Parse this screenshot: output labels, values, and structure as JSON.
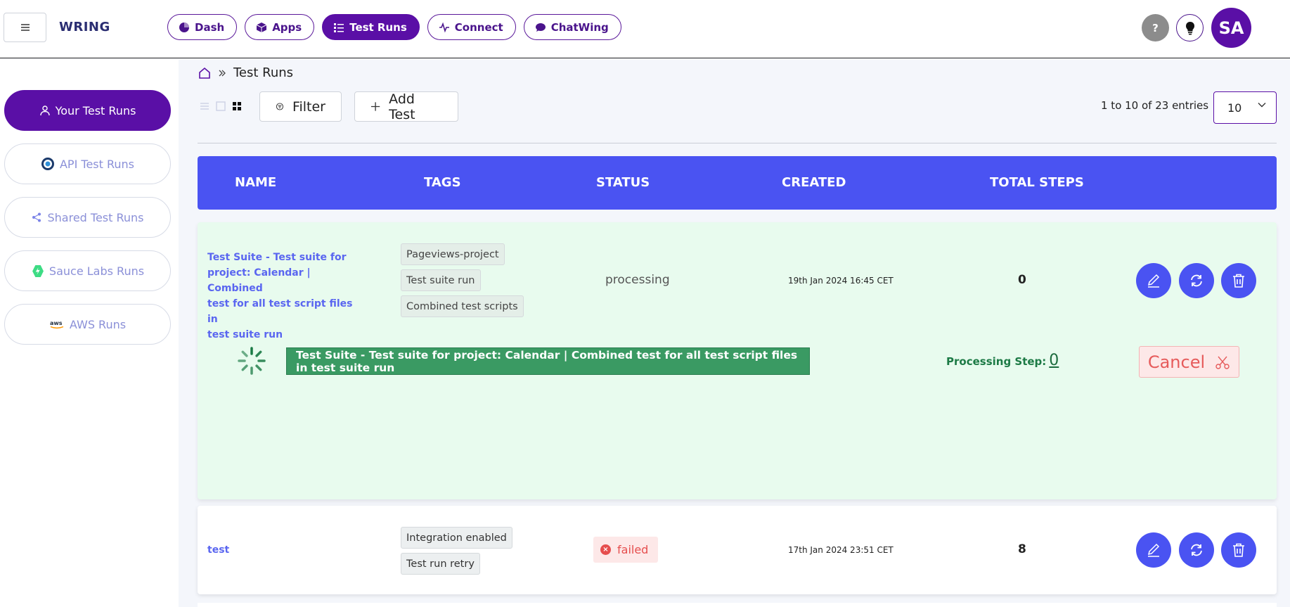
{
  "header": {
    "menu_icon": "hamburger-icon",
    "brand": "WRING",
    "nav": [
      {
        "label": "Dash",
        "icon": "pie-chart-icon"
      },
      {
        "label": "Apps",
        "icon": "cube-icon"
      },
      {
        "label": "Test Runs",
        "icon": "list-icon",
        "active": true
      },
      {
        "label": "Connect",
        "icon": "pulse-icon"
      },
      {
        "label": "ChatWing",
        "icon": "chat-bubble-icon"
      }
    ],
    "help_label": "?",
    "avatar_initials": "SA"
  },
  "sidebar": {
    "items": [
      {
        "label": "Your Test Runs",
        "icon": "user-icon",
        "active": true
      },
      {
        "label": "API Test Runs",
        "icon": "api-globe-icon"
      },
      {
        "label": "Shared Test Runs",
        "icon": "share-icon"
      },
      {
        "label": "Sauce Labs Runs",
        "icon": "saucelabs-icon"
      },
      {
        "label": "AWS Runs",
        "icon": "aws-icon"
      }
    ]
  },
  "breadcrumb": {
    "current": "Test Runs"
  },
  "toolbar": {
    "filter_label": "Filter",
    "add_label": "Add Test",
    "entries_text": "1 to 10 of 23 entries",
    "page_size": "10"
  },
  "table": {
    "columns": [
      "NAME",
      "TAGS",
      "STATUS",
      "CREATED",
      "TOTAL STEPS"
    ],
    "rows": [
      {
        "name_lines": [
          "Test Suite - Test suite for",
          "project: Calendar | Combined",
          "test for all test script files in",
          "test suite run"
        ],
        "tags": [
          "Pageviews-project",
          "Test suite run",
          "Combined test scripts"
        ],
        "status": "processing",
        "created": "19th Jan 2024 16:45 CET",
        "total_steps": "0",
        "processing": {
          "banner": "Test Suite - Test suite for project: Calendar | Combined test for all test script files in test suite run",
          "step_label": "Processing Step:",
          "step_value": "0",
          "cancel_label": "Cancel"
        }
      },
      {
        "name_lines": [
          "test"
        ],
        "tags": [
          "Integration enabled",
          "Test run retry"
        ],
        "status": "failed",
        "created": "17th Jan 2024 23:51 CET",
        "total_steps": "8"
      }
    ]
  },
  "colors": {
    "brand_purple": "#5a0fa6",
    "header_blue": "#4a53f2",
    "processing_bg": "#e8fbee",
    "processing_green": "#3a9a63",
    "failed_red": "#e64e4e"
  }
}
